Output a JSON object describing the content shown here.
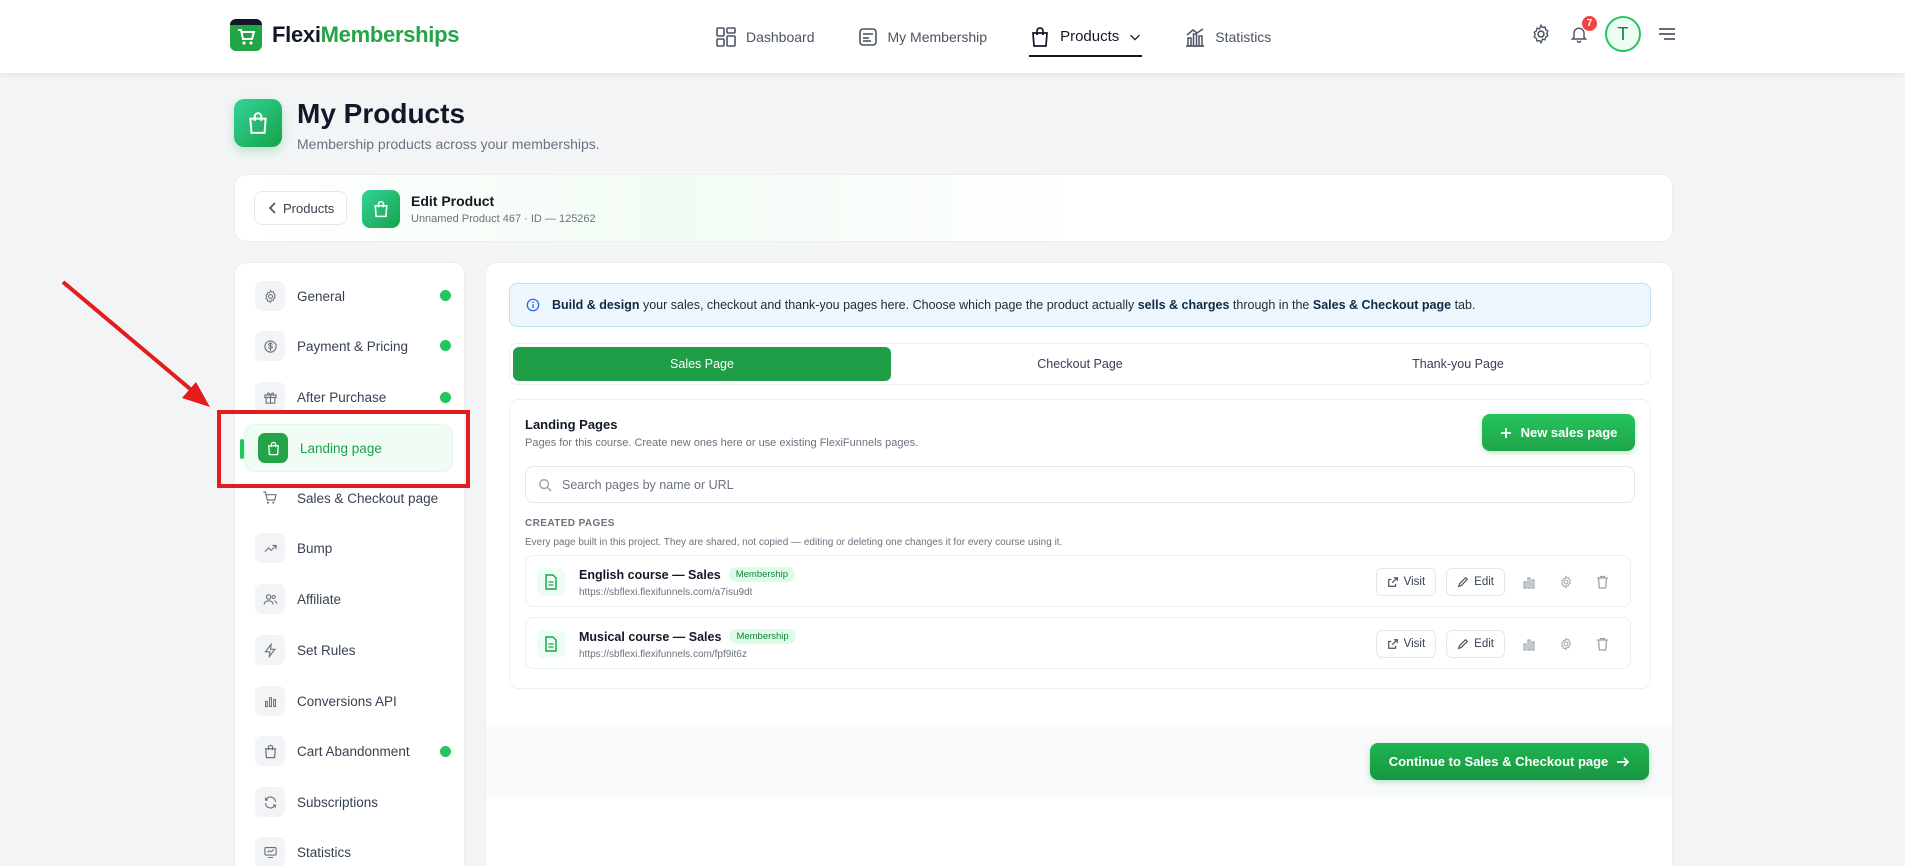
{
  "brand": {
    "name_part1": "Flexi",
    "name_part2": "Memberships",
    "color": "#22a447"
  },
  "nav": {
    "items": [
      {
        "label": "Dashboard",
        "icon": "dashboard-grid-icon"
      },
      {
        "label": "My Membership",
        "icon": "membership-card-icon"
      },
      {
        "label": "Products",
        "icon": "shopping-bag-icon",
        "active": true
      },
      {
        "label": "Statistics",
        "icon": "bar-chart-icon"
      }
    ],
    "notification_count": "7",
    "avatar_initial": "T"
  },
  "header": {
    "title": "My Products",
    "subtitle": "Membership products across your memberships."
  },
  "edit_bar": {
    "back_label": "Products",
    "title": "Edit Product",
    "meta": "Unnamed Product 467 · ID — 125262"
  },
  "sidebar": {
    "items": [
      {
        "label": "General",
        "icon": "gear-icon",
        "done": true
      },
      {
        "label": "Payment & Pricing",
        "icon": "dollar-icon",
        "done": true
      },
      {
        "label": "After Purchase",
        "icon": "gift-icon",
        "done": true
      },
      {
        "label": "Landing page",
        "icon": "shopping-bag-icon",
        "active": true
      },
      {
        "label": "Sales & Checkout page",
        "icon": "cart-icon"
      },
      {
        "label": "Bump",
        "icon": "trend-up-icon"
      },
      {
        "label": "Affiliate",
        "icon": "users-icon"
      },
      {
        "label": "Set Rules",
        "icon": "lightning-icon"
      },
      {
        "label": "Conversions API",
        "icon": "bar-chart-icon"
      },
      {
        "label": "Cart Abandonment",
        "icon": "bag-icon",
        "done": true
      },
      {
        "label": "Subscriptions",
        "icon": "refresh-icon"
      },
      {
        "label": "Statistics",
        "icon": "monitor-icon"
      }
    ]
  },
  "info": {
    "b1": "Build & design",
    "t1": " your sales, checkout and thank-you pages here. Choose which page the product actually ",
    "b2": "sells & charges",
    "t2": " through in the ",
    "b3": "Sales & Checkout page",
    "t3": " tab."
  },
  "tabs": [
    {
      "label": "Sales Page",
      "active": true
    },
    {
      "label": "Checkout Page"
    },
    {
      "label": "Thank-you Page"
    }
  ],
  "landing": {
    "title": "Landing Pages",
    "subtitle": "Pages for this course. Create new ones here or use existing FlexiFunnels pages.",
    "new_button": "New sales page",
    "search_placeholder": "Search pages by name or URL",
    "created_label": "CREATED PAGES",
    "created_desc": "Every page built in this project. They are shared, not copied — editing or deleting one changes it for every course using it.",
    "pages": [
      {
        "name": "English course — Sales",
        "badge": "Membership",
        "url": "https://sbflexi.flexifunnels.com/a7isu9dt"
      },
      {
        "name": "Musical course — Sales",
        "badge": "Membership",
        "url": "https://sbflexi.flexifunnels.com/fpf9it6z"
      }
    ],
    "visit_label": "Visit",
    "edit_label": "Edit"
  },
  "continue_button": "Continue to Sales & Checkout page",
  "colors": {
    "accent": "#22a447",
    "annotation": "#e11d1d",
    "info_bg": "#eef7fd"
  }
}
